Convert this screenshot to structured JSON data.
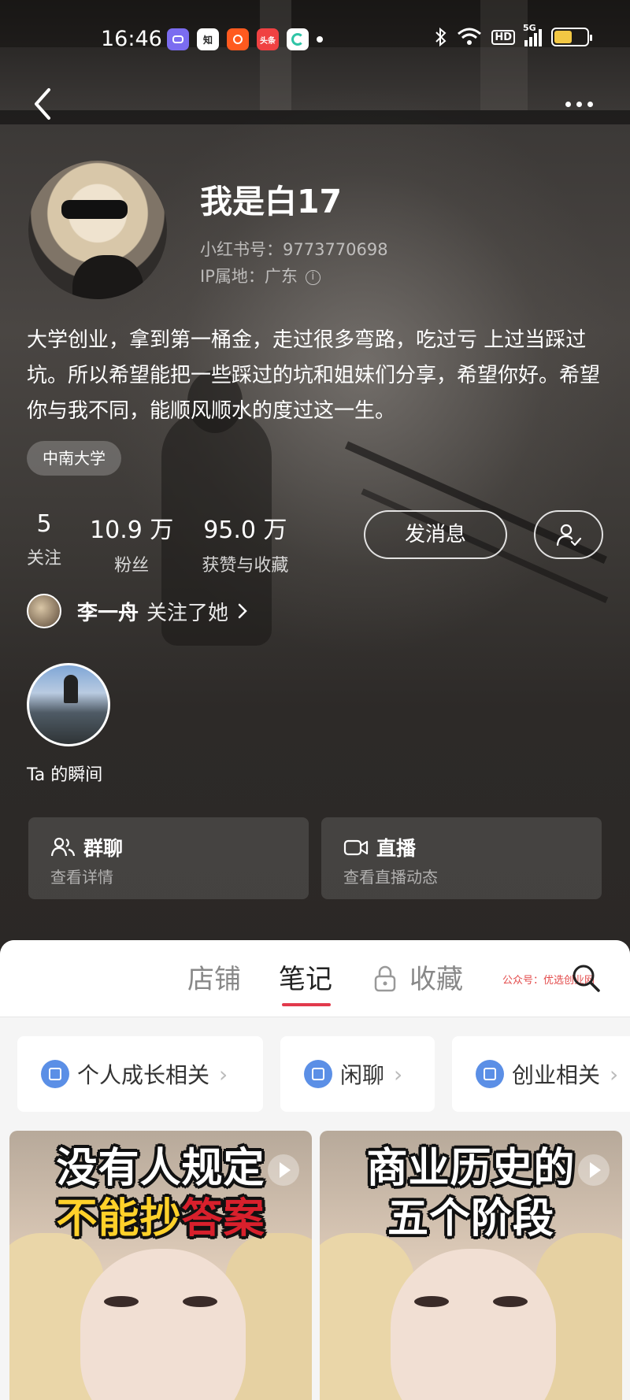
{
  "status_bar": {
    "time": "16:46",
    "apps": [
      {
        "name": "chat-app-icon",
        "label": "",
        "color": "#7b6cf0"
      },
      {
        "name": "zhihu-app-icon",
        "label": "知",
        "color": "#ffffff"
      },
      {
        "name": "kuaishou-app-icon",
        "label": "",
        "color": "#ff5a1f"
      },
      {
        "name": "toutiao-app-icon",
        "label": "头条",
        "color": "#f04142"
      },
      {
        "name": "refresh-app-icon",
        "label": "",
        "color": "#2ec4a6"
      }
    ],
    "network": "5G",
    "hd": "HD",
    "battery_level": 0.55
  },
  "profile": {
    "name": "我是白17",
    "red_id": "小红书号：9773770698",
    "ip_location": "IP属地：广东",
    "bio": "大学创业，拿到第一桶金，走过很多弯路，吃过亏 上过当踩过坑。所以希望能把一些踩过的坑和姐妹们分享，希望你好。希望你与我不同，能顺风顺水的度过这一生。",
    "tag": "中南大学"
  },
  "stats": [
    {
      "value": "5",
      "label": "关注"
    },
    {
      "value": "10.9 万",
      "label": "粉丝"
    },
    {
      "value": "95.0 万",
      "label": "获赞与收藏"
    }
  ],
  "actions": {
    "message_label": "发消息"
  },
  "mutual": {
    "name": "李一舟",
    "text": "关注了她"
  },
  "moments": {
    "label": "Ta 的瞬间"
  },
  "cards": [
    {
      "title": "群聊",
      "subtitle": "查看详情"
    },
    {
      "title": "直播",
      "subtitle": "查看直播动态"
    }
  ],
  "tabs": [
    {
      "label": "店铺"
    },
    {
      "label": "笔记"
    },
    {
      "label": "收藏"
    }
  ],
  "watermark": "公众号：优选创业网",
  "albums": [
    {
      "label": "个人成长相关"
    },
    {
      "label": "闲聊"
    },
    {
      "label": "创业相关"
    }
  ],
  "notes": [
    {
      "line1": "没有人规定",
      "line2a": "不能抄",
      "line2b": "答案"
    },
    {
      "line1": "商业历史的",
      "line2": "五个阶段"
    }
  ],
  "colors": {
    "accent": "#e23a4c",
    "album_icon": "#5b8fe6",
    "sheet_bg": "#f5f5f5"
  }
}
